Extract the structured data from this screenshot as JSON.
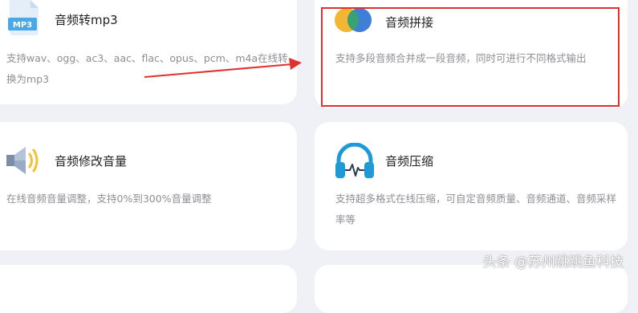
{
  "cards": [
    {
      "title": "音频转mp3",
      "description": "支持wav、ogg、ac3、aac、flac、opus、pcm、m4a在线转换为mp3",
      "icon": "mp3-file-icon",
      "icon_text": "MP3"
    },
    {
      "title": "音频拼接",
      "description": "支持多段音频合并成一段音频，同时可进行不同格式输出",
      "icon": "overlapping-circles-icon"
    },
    {
      "title": "音频修改音量",
      "description": "在线音频音量调整，支持0%到300%音量调整",
      "icon": "speaker-volume-icon"
    },
    {
      "title": "音频压缩",
      "description": "支持超多格式在线压缩，可自定音频质量、音频通道、音频采样率等",
      "icon": "headphones-icon"
    }
  ],
  "annotation": {
    "highlight_color": "#e03030"
  },
  "watermark": "头条 @苏州跳跳鱼科技",
  "colors": {
    "background": "#f0f1f6",
    "card": "#ffffff",
    "title": "#222222",
    "description": "#8e8e95",
    "mp3_icon": "#4aa8e6",
    "circle_yellow": "#f2b632",
    "circle_blue": "#3f7fd8",
    "circle_green": "#3aa272",
    "headphones": "#1f9ad6"
  }
}
